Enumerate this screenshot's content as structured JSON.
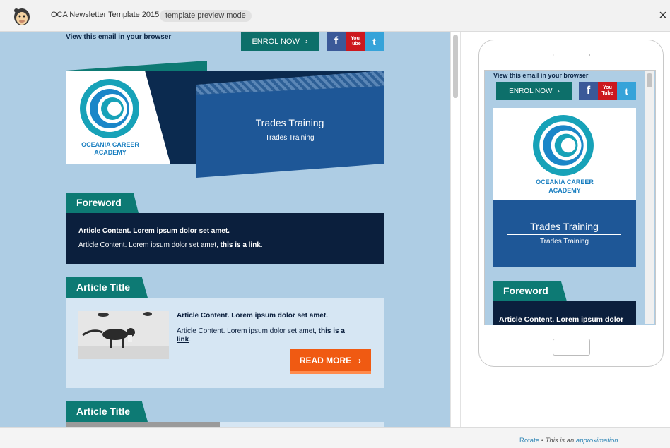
{
  "header": {
    "title": "OCA Newsletter Template 2015",
    "mode_badge": "template preview mode"
  },
  "email": {
    "view_in_browser": "View this email in your browser",
    "enrol_button": "ENROL NOW",
    "social": {
      "facebook": "f",
      "youtube_top": "You",
      "youtube_bottom": "Tube",
      "twitter": "t"
    },
    "logo_line1": "OCEANIA CAREER",
    "logo_line2": "ACADEMY",
    "banner_title": "Trades Training",
    "banner_subtitle": "Trades Training",
    "foreword": {
      "tab": "Foreword",
      "line1": "Article Content. Lorem ipsum dolor set amet.",
      "line2_text": "Article Content. Lorem ipsum dolor set amet, ",
      "line2_link": "this is a link",
      "line2_end": "."
    },
    "article": {
      "tab": "Article Title",
      "line1": "Article Content. Lorem ipsum dolor set amet.",
      "line2_text": "Article Content. Lorem ipsum dolor set amet, ",
      "line2_link_a": "this is a",
      "line2_link_b": "link",
      "line2_end": ".",
      "read_more": "READ MORE"
    },
    "article2": {
      "tab": "Article Title"
    }
  },
  "mobile": {
    "foreword_line1": "Article Content. Lorem ipsum dolor"
  },
  "footer": {
    "rotate": "Rotate",
    "separator": " • ",
    "approx_text": "This is an ",
    "approx_link": "approximation"
  },
  "colors": {
    "teal": "#0d7a74",
    "navy": "#0b1f3d",
    "blue": "#1e5797",
    "sky": "#aecde4",
    "orange": "#f05a12"
  }
}
